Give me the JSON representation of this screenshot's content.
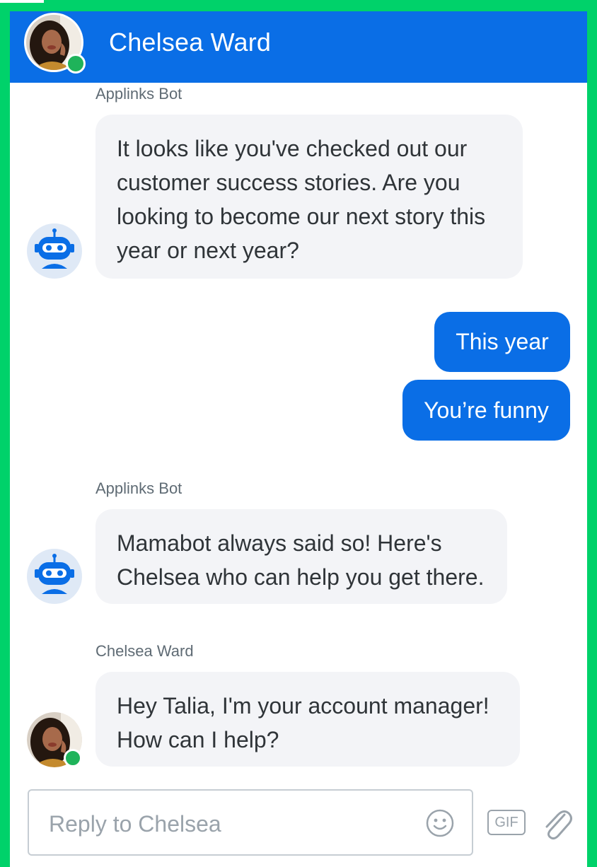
{
  "header": {
    "contact_name": "Chelsea Ward"
  },
  "messages": [
    {
      "sender": "Applinks Bot",
      "lines": [
        "It looks like you've checked out our",
        "customer success stories. Are you",
        "looking to become our next story this",
        "year or next year?"
      ]
    },
    {
      "sender": "Applinks Bot",
      "lines": [
        "Mamabot always said so! Here's",
        "Chelsea who can help you get there."
      ]
    },
    {
      "sender": "Chelsea Ward",
      "lines": [
        "Hey Talia, I'm your account manager!",
        "How can I help?"
      ]
    }
  ],
  "quick_replies": [
    {
      "label": "This year"
    },
    {
      "label": "You’re funny"
    }
  ],
  "composer": {
    "placeholder": "Reply to Chelsea",
    "value": "",
    "emoji_icon": "smiley-icon",
    "gif_label": "GIF",
    "attach_icon": "paperclip-icon"
  },
  "colors": {
    "brand_blue": "#0a6ee6",
    "online_green": "#1fb35a",
    "page_border": "#00d26a",
    "bubble_gray": "#f3f4f7"
  }
}
